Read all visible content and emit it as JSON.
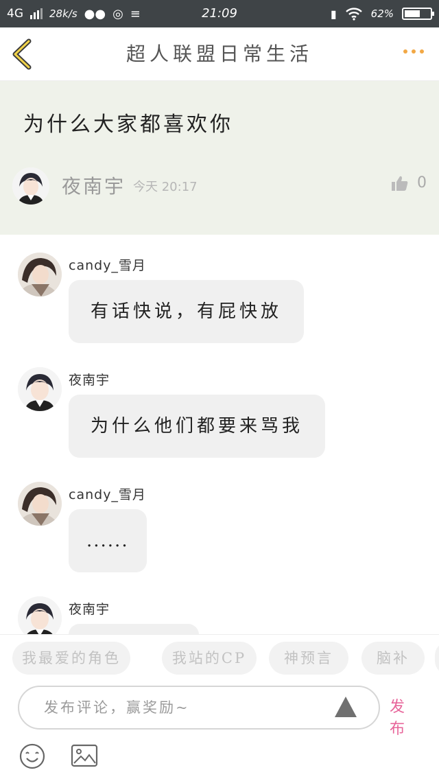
{
  "status_bar": {
    "network": "4G",
    "speed": "28k/s",
    "time": "21:09",
    "battery": "62%",
    "battery_level": 0.62
  },
  "nav": {
    "title": "超人联盟日常生活"
  },
  "post": {
    "text": "为什么大家都喜欢你",
    "author": "夜南宇",
    "time": "今天 20:17",
    "likes": "0"
  },
  "comments": [
    {
      "name": "candy_雪月",
      "text": "有话快说，有屁快放",
      "avatar": "avatar-candy"
    },
    {
      "name": "夜南宇",
      "text": "为什么他们都要来骂我",
      "avatar": "avatar-yenanyu"
    },
    {
      "name": "candy_雪月",
      "text": "......",
      "avatar": "avatar-candy"
    },
    {
      "name": "夜南宇",
      "text": "",
      "avatar": "avatar-yenanyu"
    }
  ],
  "tags": [
    "我最爱的角色",
    "我站的CP",
    "神预言",
    "脑补"
  ],
  "input": {
    "placeholder": "发布评论，赢奖励~",
    "publish_label": "发 布"
  },
  "colors": {
    "accent": "#f2a845",
    "publish": "#e7659a",
    "post_bg": "#eff2ea",
    "bubble_bg": "#f0f0f0"
  }
}
